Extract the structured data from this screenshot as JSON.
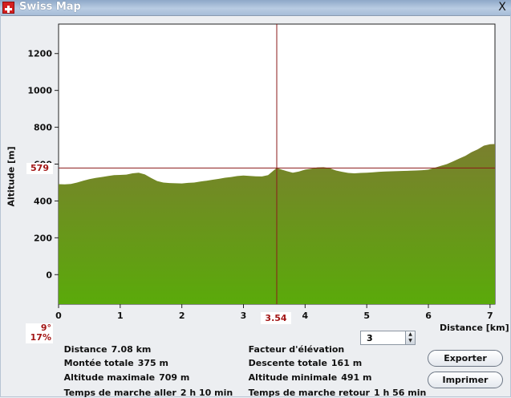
{
  "window": {
    "title": "Swiss Map",
    "close_label": "X"
  },
  "chart_data": {
    "type": "area",
    "x": [
      0,
      0.1,
      0.2,
      0.3,
      0.4,
      0.5,
      0.6,
      0.7,
      0.8,
      0.9,
      1.0,
      1.1,
      1.2,
      1.3,
      1.4,
      1.5,
      1.6,
      1.7,
      1.8,
      1.9,
      2.0,
      2.1,
      2.2,
      2.3,
      2.4,
      2.5,
      2.6,
      2.7,
      2.8,
      2.9,
      3.0,
      3.1,
      3.2,
      3.3,
      3.4,
      3.5,
      3.54,
      3.6,
      3.7,
      3.8,
      3.9,
      4.0,
      4.1,
      4.2,
      4.3,
      4.4,
      4.5,
      4.6,
      4.7,
      4.8,
      4.9,
      5.0,
      5.1,
      5.2,
      5.3,
      5.4,
      5.5,
      5.6,
      5.7,
      5.8,
      5.9,
      6.0,
      6.1,
      6.2,
      6.3,
      6.4,
      6.5,
      6.6,
      6.7,
      6.8,
      6.9,
      7.0,
      7.08
    ],
    "y": [
      491,
      490,
      492,
      500,
      510,
      518,
      525,
      530,
      535,
      540,
      541,
      543,
      550,
      553,
      544,
      525,
      508,
      500,
      497,
      496,
      495,
      498,
      500,
      505,
      510,
      515,
      520,
      526,
      530,
      535,
      538,
      536,
      534,
      533,
      540,
      568,
      579,
      572,
      562,
      553,
      560,
      570,
      575,
      582,
      583,
      578,
      565,
      558,
      552,
      550,
      552,
      553,
      555,
      558,
      560,
      561,
      562,
      563,
      564,
      565,
      567,
      570,
      580,
      590,
      600,
      615,
      630,
      645,
      665,
      680,
      700,
      708,
      709
    ],
    "xlabel": "Distance [km]",
    "ylabel": "Altitude [m]",
    "x_ticks": [
      "0",
      "1",
      "2",
      "3",
      "4",
      "5",
      "6",
      "7"
    ],
    "y_ticks": [
      "0",
      "200",
      "400",
      "600",
      "800",
      "1000",
      "1200"
    ],
    "xlim": [
      0,
      7.08
    ],
    "ylim": [
      -160,
      1360
    ],
    "fill_colors": [
      "#7a7f2e",
      "#5aaa0a"
    ],
    "cursor_color": "#8b1a1a",
    "grid": false
  },
  "cursor": {
    "altitude": "579",
    "distance": "3.54",
    "slope_deg": "9°",
    "slope_pct": "17%"
  },
  "stats": {
    "distance_label": "Distance",
    "distance_value": "7.08 km",
    "ascent_label": "Montée totale",
    "ascent_value": "375 m",
    "max_alt_label": "Altitude maximale",
    "max_alt_value": "709 m",
    "time_out_label": "Temps de marche aller",
    "time_out_value": "2 h 10 min",
    "elev_factor_label": "Facteur d'élévation",
    "descent_label": "Descente totale",
    "descent_value": "161 m",
    "min_alt_label": "Altitude minimale",
    "min_alt_value": "491 m",
    "time_back_label": "Temps de marche retour",
    "time_back_value": "1 h 56 min"
  },
  "controls": {
    "elevation_factor": "3",
    "export_label": "Exporter",
    "print_label": "Imprimer"
  }
}
